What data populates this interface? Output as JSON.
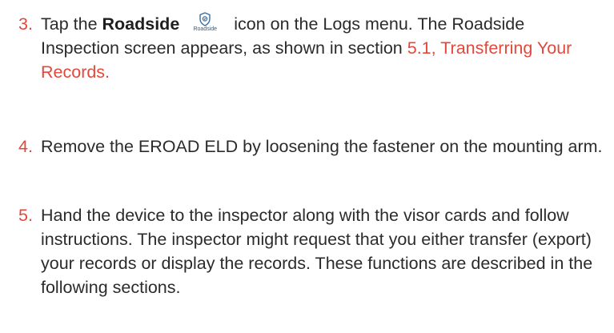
{
  "steps": [
    {
      "number": "3.",
      "text_before": "Tap the ",
      "keyword": "Roadside",
      "icon": {
        "name": "roadside-shield-icon",
        "caption": "Roadside",
        "color": "#3a6ea5"
      },
      "text_after": " icon on the Logs menu. The Roadside Inspection screen appears, as shown in section ",
      "link": "5.1, Transferring Your Records."
    },
    {
      "number": "4.",
      "text": "Remove the EROAD ELD by loosening the fastener on the mounting arm."
    },
    {
      "number": "5.",
      "text": "Hand the device to the inspector along with the visor cards and follow instructions. The inspector might request that you either transfer (export) your records or display the records. These functions are described in the following sections."
    }
  ],
  "colors": {
    "number": "#e2483b",
    "link": "#e2483b",
    "text": "#2b2b2b"
  }
}
